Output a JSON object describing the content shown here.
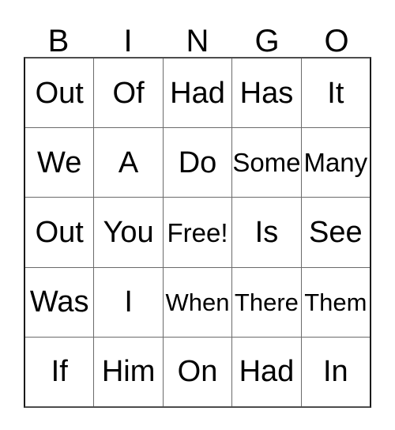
{
  "card": {
    "header_letters": [
      "B",
      "I",
      "N",
      "G",
      "O"
    ],
    "text_color": "#000000",
    "background_color": "#ffffff",
    "border_color": "#1a1a1a",
    "gridline_color": "#6b6b6b",
    "rows": [
      [
        {
          "text": "Out",
          "size": "lg"
        },
        {
          "text": "Of",
          "size": "lg"
        },
        {
          "text": "Had",
          "size": "lg"
        },
        {
          "text": "Has",
          "size": "lg"
        },
        {
          "text": "It",
          "size": "lg"
        }
      ],
      [
        {
          "text": "We",
          "size": "lg"
        },
        {
          "text": "A",
          "size": "lg"
        },
        {
          "text": "Do",
          "size": "lg"
        },
        {
          "text": "Some",
          "size": "md"
        },
        {
          "text": "Many",
          "size": "md"
        }
      ],
      [
        {
          "text": "Out",
          "size": "lg"
        },
        {
          "text": "You",
          "size": "lg"
        },
        {
          "text": "Free!",
          "size": "md"
        },
        {
          "text": "Is",
          "size": "lg"
        },
        {
          "text": "See",
          "size": "lg"
        }
      ],
      [
        {
          "text": "Was",
          "size": "lg"
        },
        {
          "text": "I",
          "size": "lg"
        },
        {
          "text": "When",
          "size": "sm"
        },
        {
          "text": "There",
          "size": "sm"
        },
        {
          "text": "Them",
          "size": "sm"
        }
      ],
      [
        {
          "text": "If",
          "size": "lg"
        },
        {
          "text": "Him",
          "size": "lg"
        },
        {
          "text": "On",
          "size": "lg"
        },
        {
          "text": "Had",
          "size": "lg"
        },
        {
          "text": "In",
          "size": "lg"
        }
      ]
    ]
  }
}
